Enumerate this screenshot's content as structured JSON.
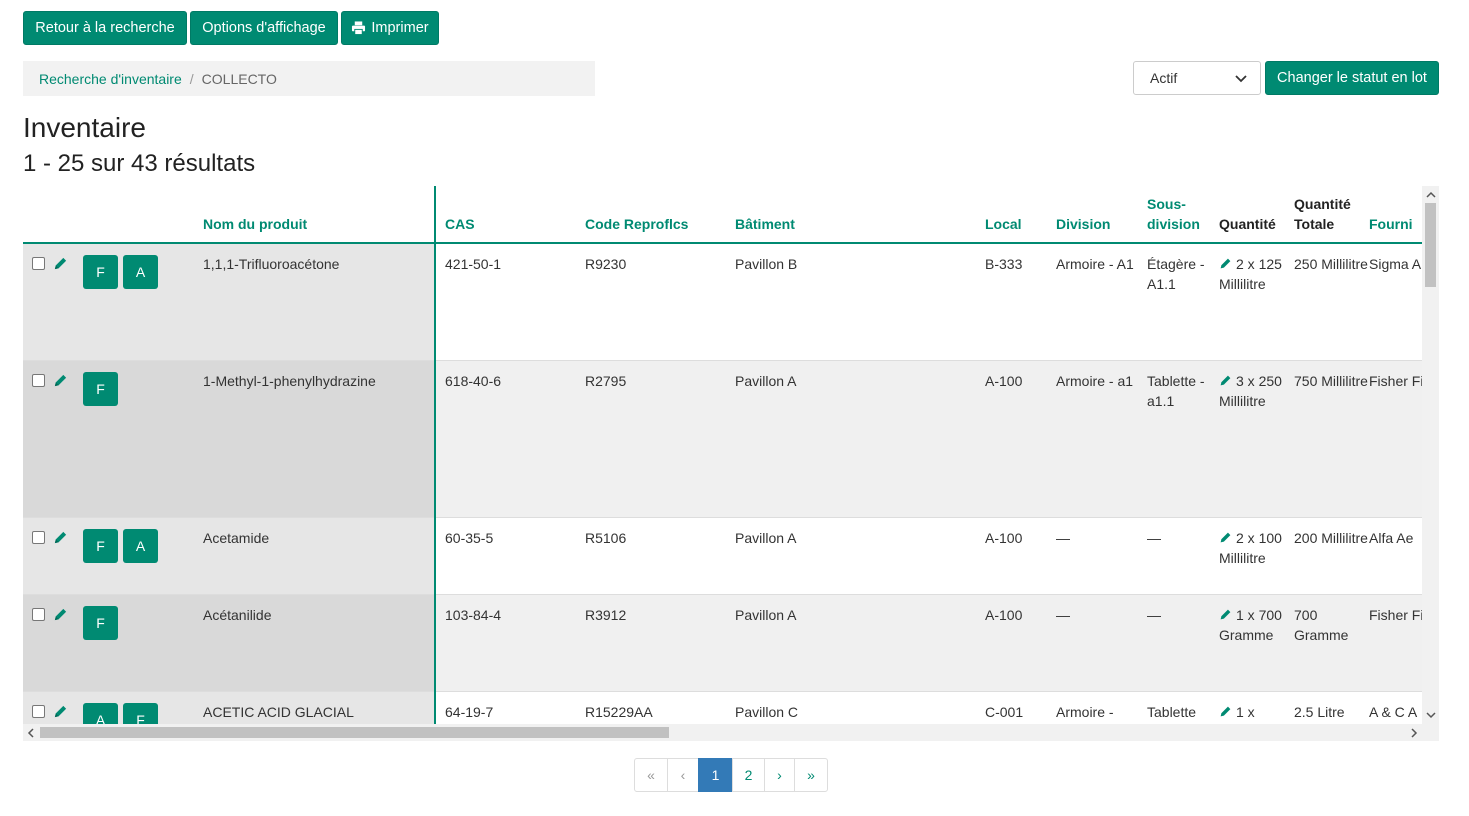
{
  "toolbar": {
    "back_label": "Retour à la recherche",
    "display_options_label": "Options d'affichage",
    "print_label": "Imprimer",
    "print_icon": "printer-icon"
  },
  "breadcrumb": {
    "link": "Recherche d'inventaire",
    "separator": "/",
    "current": "COLLECTO"
  },
  "status_filter": {
    "selected": "Actif"
  },
  "batch_button_label": "Changer le statut en lot",
  "page": {
    "title": "Inventaire",
    "result_count": "1 - 25 sur 43 résultats"
  },
  "table": {
    "headers": {
      "product": "Nom du produit",
      "cas": "CAS",
      "code": "Code Reproflcs",
      "building": "Bâtiment",
      "local": "Local",
      "division": "Division",
      "subdivision": "Sous-division",
      "quantity": "Quantité",
      "total": "Quantité Totale",
      "supplier": "Fourni"
    },
    "rows": [
      {
        "badges": [
          "F",
          "A"
        ],
        "product": "1,1,1-Trifluoroacétone",
        "cas": "421-50-1",
        "code": "R9230",
        "building": "Pavillon B",
        "local": "B-333",
        "division": "Armoire - A1",
        "subdivision": "Étagère - A1.1",
        "quantity": "2 x 125 Millilitre",
        "total": "250 Millilitre",
        "supplier": "Sigma A"
      },
      {
        "badges": [
          "F"
        ],
        "product": "1-Methyl-1-phenylhydrazine",
        "cas": "618-40-6",
        "code": "R2795",
        "building": "Pavillon A",
        "local": "A-100",
        "division": "Armoire - a1",
        "subdivision": "Tablette - a1.1",
        "quantity": "3 x 250 Millilitre",
        "total": "750 Millilitre",
        "supplier": "Fisher Fisher"
      },
      {
        "badges": [
          "F",
          "A"
        ],
        "product": "Acetamide",
        "cas": "60-35-5",
        "code": "R5106",
        "building": "Pavillon A",
        "local": "A-100",
        "division": "—",
        "subdivision": "—",
        "quantity": "2 x 100 Millilitre",
        "total": "200 Millilitre",
        "supplier": "Alfa Ae"
      },
      {
        "badges": [
          "F"
        ],
        "product": "Acétanilide",
        "cas": "103-84-4",
        "code": "R3912",
        "building": "Pavillon A",
        "local": "A-100",
        "division": "—",
        "subdivision": "—",
        "quantity": "1 x 700 Gramme",
        "total": "700 Gramme",
        "supplier": "Fisher Fisher"
      },
      {
        "badges": [
          "A",
          "F"
        ],
        "product": "ACETIC ACID GLACIAL TECHNICAL",
        "cas": "64-19-7",
        "code": "R15229AA",
        "building": "Pavillon C",
        "local": "C-001",
        "division": "Armoire -",
        "subdivision": "Tablette",
        "quantity": "1 x",
        "total": "2.5 Litre",
        "supplier": "A & C A"
      }
    ]
  },
  "pagination": {
    "first": "«",
    "prev": "‹",
    "pages": [
      "1",
      "2"
    ],
    "active": "1",
    "next": "›",
    "last": "»"
  },
  "colors": {
    "accent": "#008a72",
    "active_page": "#337ab7",
    "row_sticky_a": "#e6e6e6",
    "row_sticky_b": "#d9d9d9"
  }
}
